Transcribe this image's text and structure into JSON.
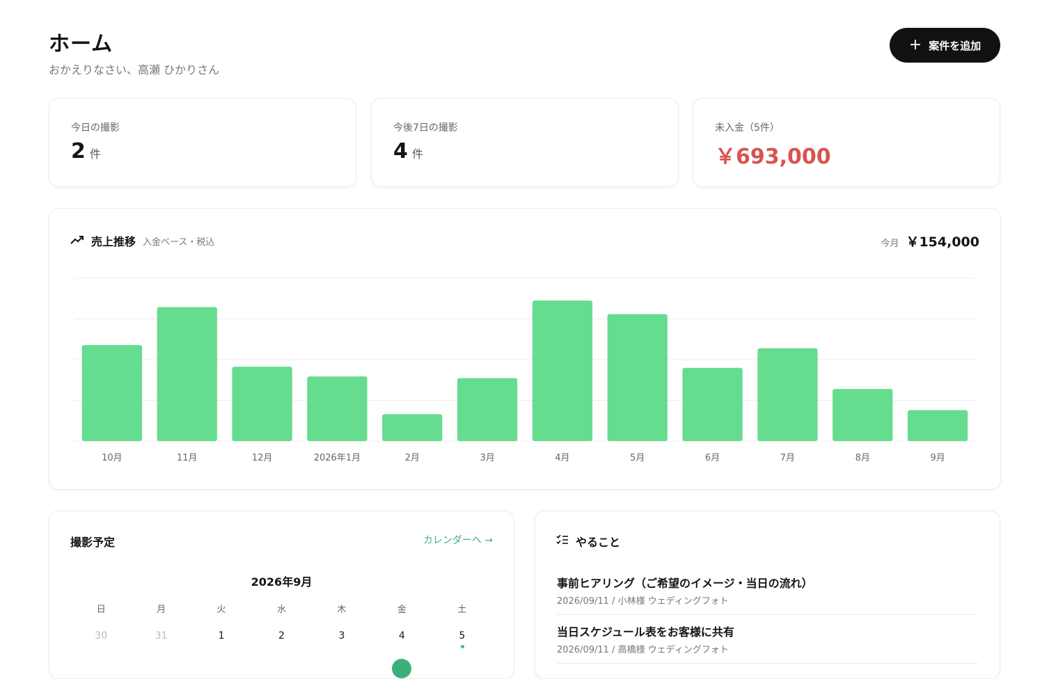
{
  "header": {
    "title": "ホーム",
    "greeting": "おかえりなさい、高瀬 ひかりさん",
    "add_button": "案件を追加"
  },
  "stats": [
    {
      "label": "今日の撮影",
      "value": "2",
      "unit": "件"
    },
    {
      "label": "今後7日の撮影",
      "value": "4",
      "unit": "件"
    },
    {
      "label": "未入金（5件）",
      "value": "￥693,000"
    }
  ],
  "sales": {
    "title": "売上推移",
    "subtitle": "入金ベース・税込",
    "current_label": "今月",
    "current_value": "￥154,000"
  },
  "chart_data": {
    "type": "bar",
    "categories": [
      "10月",
      "11月",
      "12月",
      "2026年1月",
      "2月",
      "3月",
      "4月",
      "5月",
      "6月",
      "7月",
      "8月",
      "9月"
    ],
    "values": [
      354000,
      494000,
      274000,
      238000,
      99000,
      232000,
      518000,
      468000,
      270000,
      342000,
      192000,
      114000
    ],
    "ylim": [
      0,
      600000
    ],
    "grid": true,
    "colors": {
      "bar": "#66dc8f"
    }
  },
  "schedule": {
    "title": "撮影予定",
    "calendar_link": "カレンダーへ →",
    "month": "2026年9月",
    "weekdays": [
      "日",
      "月",
      "火",
      "水",
      "木",
      "金",
      "土"
    ],
    "days": [
      {
        "d": "30",
        "muted": true,
        "marked": false
      },
      {
        "d": "31",
        "muted": true,
        "marked": false
      },
      {
        "d": "1",
        "muted": false,
        "marked": false
      },
      {
        "d": "2",
        "muted": false,
        "marked": false
      },
      {
        "d": "3",
        "muted": false,
        "marked": false
      },
      {
        "d": "4",
        "muted": false,
        "marked": false
      },
      {
        "d": "5",
        "muted": false,
        "marked": true
      }
    ]
  },
  "todo": {
    "title": "やること",
    "items": [
      {
        "title": "事前ヒアリング（ご希望のイメージ・当日の流れ）",
        "meta": "2026/09/11 / 小林様 ウェディングフォト"
      },
      {
        "title": "当日スケジュール表をお客様に共有",
        "meta": "2026/09/11 / 高橋様 ウェディングフォト"
      }
    ]
  },
  "icons": {
    "trend": "trending-up-icon",
    "checklist": "checklist-icon",
    "plus": "plus-icon"
  },
  "colors": {
    "accent": "#3fb27a",
    "danger": "#d9534f",
    "bar": "#66dc8f",
    "button": "#111111"
  }
}
